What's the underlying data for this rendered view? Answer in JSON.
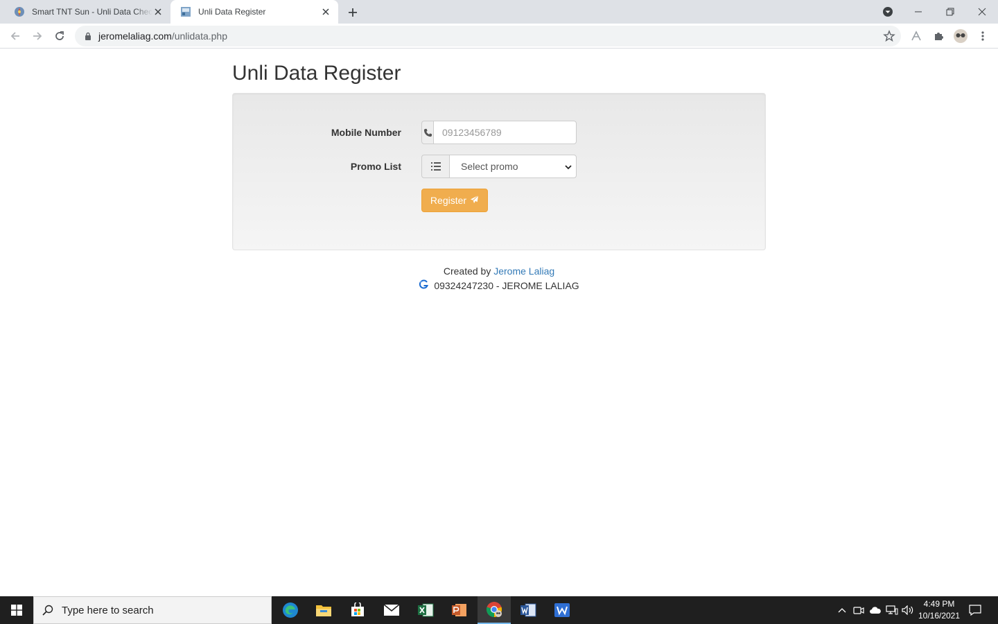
{
  "browser": {
    "tabs": [
      {
        "title": "Smart TNT Sun - Unli Data Checker"
      },
      {
        "title": "Unli Data Register"
      }
    ],
    "url_domain": "jeromelaliag.com",
    "url_path": "/unlidata.php"
  },
  "page": {
    "title": "Unli Data Register",
    "mobile_label": "Mobile Number",
    "mobile_placeholder": "09123456789",
    "promo_label": "Promo List",
    "promo_selected": "Select promo",
    "register_label": "Register",
    "footer_created_by": "Created by",
    "footer_author": "Jerome Laliag",
    "footer_contact": "09324247230 - JEROME LALIAG"
  },
  "taskbar": {
    "search_placeholder": "Type here to search",
    "time": "4:49 PM",
    "date": "10/16/2021"
  },
  "colors": {
    "register_button": "#f0ad4e",
    "link": "#337ab7",
    "taskbar": "#1f1f1f"
  }
}
